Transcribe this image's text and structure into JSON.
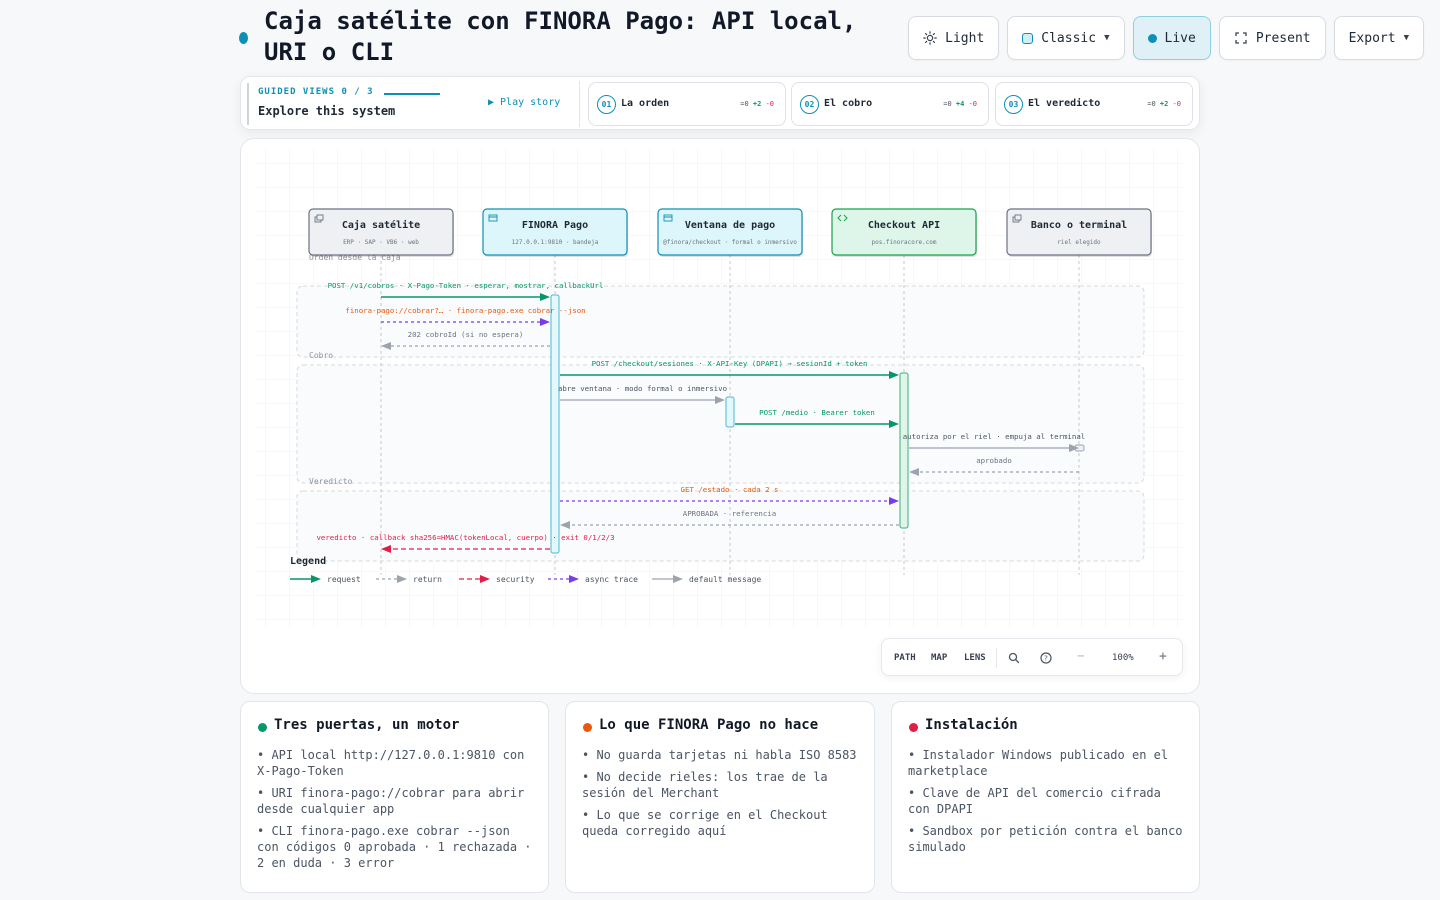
{
  "header": {
    "title": "Caja satélite con FINORA Pago: API local, URI o CLI",
    "accent_color": "#0e8fb8"
  },
  "toolbar": {
    "theme_label": "Light",
    "theme_icon": "sun-icon",
    "style_label": "Classic",
    "live_label": "Live",
    "present_label": "Present",
    "present_icon": "fullscreen-icon",
    "export_label": "Export"
  },
  "guided": {
    "kicker": "GUIDED VIEWS 0 / 3",
    "subtitle": "Explore this system",
    "play_label": "▶ Play story",
    "steps": [
      {
        "num": "01",
        "label": "La orden",
        "eq": "=0",
        "plus": "+2",
        "minus": "-0"
      },
      {
        "num": "02",
        "label": "El cobro",
        "eq": "=0",
        "plus": "+4",
        "minus": "-0"
      },
      {
        "num": "03",
        "label": "El veredicto",
        "eq": "=0",
        "plus": "+2",
        "minus": "-0"
      }
    ]
  },
  "diagram": {
    "participants": [
      {
        "name": "Caja satélite",
        "sub": "ERP · SAP · VB6 · web",
        "icon": "window-stack-icon",
        "style": "gray"
      },
      {
        "name": "FINORA Pago",
        "sub": "127.0.0.1:9810 · bandeja",
        "icon": "app-window-icon",
        "style": "cyan"
      },
      {
        "name": "Ventana de pago",
        "sub": "@finora/checkout · formal o inmersivo",
        "icon": "app-window-icon",
        "style": "cyan"
      },
      {
        "name": "Checkout API",
        "sub": "pos.finoracore.com",
        "icon": "code-brackets-icon",
        "style": "green"
      },
      {
        "name": "Banco o terminal",
        "sub": "riel elegido",
        "icon": "window-stack-icon",
        "style": "gray"
      }
    ],
    "groups": [
      {
        "label": "Orden desde la caja"
      },
      {
        "label": "Cobro"
      },
      {
        "label": "Veredicto"
      }
    ],
    "messages": [
      {
        "from": 0,
        "to": 1,
        "kind": "request",
        "label": "POST /v1/cobros · X-Pago-Token · esperar, mostrar, callbackUrl"
      },
      {
        "from": 0,
        "to": 1,
        "kind": "async",
        "label": "finora-pago://cobrar?… · finora-pago.exe cobrar --json"
      },
      {
        "from": 1,
        "to": 0,
        "kind": "return",
        "label": "202 cobroId (si no espera)"
      },
      {
        "from": 1,
        "to": 3,
        "kind": "request",
        "label": "POST /checkout/sesiones · X-API-Key (DPAPI) → sesionId + token"
      },
      {
        "from": 1,
        "to": 2,
        "kind": "default",
        "label": "abre ventana · modo formal o inmersivo"
      },
      {
        "from": 2,
        "to": 3,
        "kind": "request",
        "label": "POST /medio · Bearer token"
      },
      {
        "from": 3,
        "to": 4,
        "kind": "default",
        "label": "autoriza por el riel · empuja al terminal"
      },
      {
        "from": 4,
        "to": 3,
        "kind": "return",
        "label": "aprobado"
      },
      {
        "from": 1,
        "to": 3,
        "kind": "async",
        "label": "GET /estado · cada 2 s"
      },
      {
        "from": 3,
        "to": 1,
        "kind": "return",
        "label": "APROBADA · referencia"
      },
      {
        "from": 1,
        "to": 0,
        "kind": "security",
        "label": "veredicto · callback sha256=HMAC(tokenLocal, cuerpo) · exit 0/1/2/3"
      }
    ],
    "legend_title": "Legend",
    "legend": [
      {
        "kind": "request",
        "label": "request"
      },
      {
        "kind": "return",
        "label": "return"
      },
      {
        "kind": "security",
        "label": "security"
      },
      {
        "kind": "async",
        "label": "async trace"
      },
      {
        "kind": "default",
        "label": "default message"
      }
    ],
    "colors": {
      "request": "#059669",
      "return": "#9ca3af",
      "security": "#e11d48",
      "async": "#7c3aed",
      "default": "#9ca3af",
      "async_label": "#ea580c"
    }
  },
  "controls": {
    "path": "PATH",
    "map": "MAP",
    "lens": "LENS",
    "zoom_out": "−",
    "zoom": "100%",
    "zoom_in": "+"
  },
  "cards": [
    {
      "title": "Tres puertas, un motor",
      "dot_color": "#059669",
      "items": [
        "• API local http://127.0.0.1:9810 con X-Pago-Token",
        "• URI finora-pago://cobrar para abrir desde cualquier app",
        "• CLI finora-pago.exe cobrar --json con códigos 0 aprobada · 1 rechazada · 2 en duda · 3 error"
      ]
    },
    {
      "title": "Lo que FINORA Pago no hace",
      "dot_color": "#ea580c",
      "items": [
        "• No guarda tarjetas ni habla ISO 8583",
        "• No decide rieles: los trae de la sesión del Merchant",
        "• Lo que se corrige en el Checkout queda corregido aquí"
      ]
    },
    {
      "title": "Instalación",
      "dot_color": "#e11d48",
      "items": [
        "• Instalador Windows publicado en el marketplace",
        "• Clave de API del comercio cifrada con DPAPI",
        "• Sandbox por petición contra el banco simulado"
      ]
    }
  ]
}
